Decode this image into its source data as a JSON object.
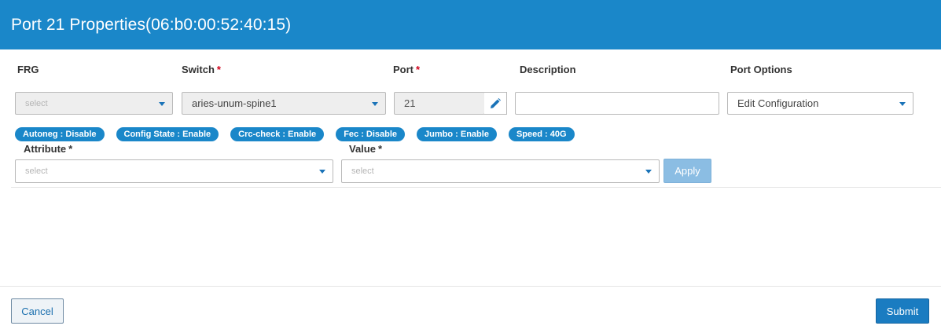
{
  "header": {
    "title": "Port 21 Properties(06:b0:00:52:40:15)"
  },
  "form": {
    "frg": {
      "label": "FRG",
      "placeholder": "select"
    },
    "switch": {
      "label": "Switch",
      "required_mark": "*",
      "value": "aries-unum-spine1"
    },
    "port": {
      "label": "Port",
      "required_mark": "*",
      "value": "21"
    },
    "description": {
      "label": "Description",
      "value": ""
    },
    "port_options": {
      "label": "Port Options",
      "value": "Edit Configuration"
    }
  },
  "tags": [
    "Autoneg : Disable",
    "Config State : Enable",
    "Crc-check : Enable",
    "Fec : Disable",
    "Jumbo : Enable",
    "Speed : 40G"
  ],
  "attribute": {
    "label": "Attribute",
    "required_mark": "*",
    "placeholder": "select"
  },
  "value_field": {
    "label": "Value",
    "required_mark": "*",
    "placeholder": "select"
  },
  "buttons": {
    "apply": "Apply",
    "cancel": "Cancel",
    "submit": "Submit"
  },
  "colors": {
    "header_bg": "#1a87c9",
    "tag_bg": "#1a87c9",
    "required": "#d0021b",
    "submit_bg": "#1a7cc1",
    "apply_bg": "#8bbde3"
  },
  "icons": {
    "edit": "pencil-icon",
    "dropdown": "chevron-down-icon"
  }
}
